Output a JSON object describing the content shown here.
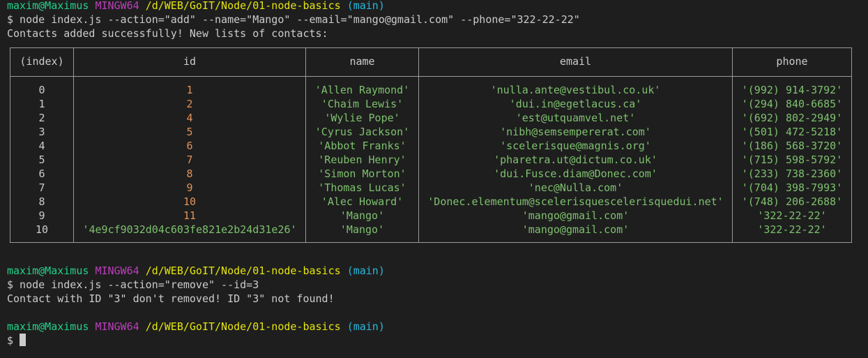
{
  "terminal": {
    "prompt1": {
      "user": "maxim@Maximus",
      "shell": "MINGW64",
      "path": "/d/WEB/GoIT/Node/01-node-basics",
      "branch": "(main)"
    },
    "cmd1": "$ node index.js --action=\"add\" --name=\"Mango\" --email=\"mango@gmail.com\" --phone=\"322-22-22\"",
    "out1": "Contacts added successfully! New lists of contacts:",
    "table": {
      "headers": [
        "(index)",
        "id",
        "name",
        "email",
        "phone"
      ],
      "rows": [
        {
          "index": "0",
          "id": "1",
          "name": "'Allen Raymond'",
          "email": "'nulla.ante@vestibul.co.uk'",
          "phone": "'(992) 914-3792'"
        },
        {
          "index": "1",
          "id": "2",
          "name": "'Chaim Lewis'",
          "email": "'dui.in@egetlacus.ca'",
          "phone": "'(294) 840-6685'"
        },
        {
          "index": "2",
          "id": "4",
          "name": "'Wylie Pope'",
          "email": "'est@utquamvel.net'",
          "phone": "'(692) 802-2949'"
        },
        {
          "index": "3",
          "id": "5",
          "name": "'Cyrus Jackson'",
          "email": "'nibh@semsempererat.com'",
          "phone": "'(501) 472-5218'"
        },
        {
          "index": "4",
          "id": "6",
          "name": "'Abbot Franks'",
          "email": "'scelerisque@magnis.org'",
          "phone": "'(186) 568-3720'"
        },
        {
          "index": "5",
          "id": "7",
          "name": "'Reuben Henry'",
          "email": "'pharetra.ut@dictum.co.uk'",
          "phone": "'(715) 598-5792'"
        },
        {
          "index": "6",
          "id": "8",
          "name": "'Simon Morton'",
          "email": "'dui.Fusce.diam@Donec.com'",
          "phone": "'(233) 738-2360'"
        },
        {
          "index": "7",
          "id": "9",
          "name": "'Thomas Lucas'",
          "email": "'nec@Nulla.com'",
          "phone": "'(704) 398-7993'"
        },
        {
          "index": "8",
          "id": "10",
          "name": "'Alec Howard'",
          "email": "'Donec.elementum@scelerisquescelerisquedui.net'",
          "phone": "'(748) 206-2688'"
        },
        {
          "index": "9",
          "id": "11",
          "name": "'Mango'",
          "email": "'mango@gmail.com'",
          "phone": "'322-22-22'"
        },
        {
          "index": "10",
          "id": "'4e9cf9032d04c603fe821e2b24d31e26'",
          "name": "'Mango'",
          "email": "'mango@gmail.com'",
          "phone": "'322-22-22'"
        }
      ]
    },
    "prompt2": {
      "user": "maxim@Maximus",
      "shell": "MINGW64",
      "path": "/d/WEB/GoIT/Node/01-node-basics",
      "branch": "(main)"
    },
    "cmd2": "$ node index.js --action=\"remove\" --id=3",
    "out2": "Contact with ID \"3\" don't removed! ID \"3\" not found!",
    "prompt3": {
      "user": "maxim@Maximus",
      "shell": "MINGW64",
      "path": "/d/WEB/GoIT/Node/01-node-basics",
      "branch": "(main)"
    },
    "cmd3": "$ "
  },
  "colors": {
    "background": "#1e1e1e",
    "user": "#23d18b",
    "shell": "#bc3fbc",
    "path": "#e5e510",
    "branch": "#29b8db",
    "string": "#7ec16e",
    "number": "#e0935a"
  }
}
